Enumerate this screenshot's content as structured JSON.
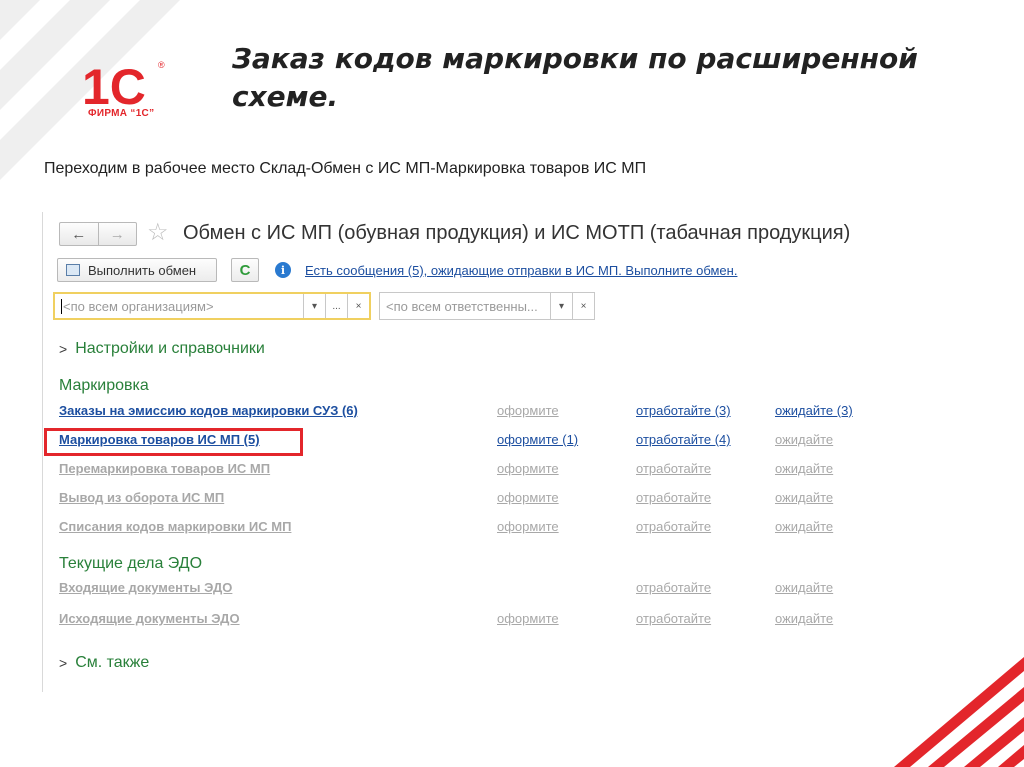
{
  "slide": {
    "title": "Заказ кодов маркировки по расширенной схеме.",
    "subtitle": "Переходим в рабочее место Склад-Обмен с ИС МП-Маркировка товаров ИС МП",
    "logo_text": "1С",
    "logo_caption": "ФИРМА “1С”"
  },
  "colors": {
    "brand_red": "#e3262b",
    "link_blue": "#1d4fa0",
    "section_green": "#29803a",
    "disabled_gray": "#a8a8a8"
  },
  "window": {
    "title": "Обмен с ИС МП (обувная продукция) и ИС МОТП (табачная продукция)",
    "nav_back": "←",
    "nav_forward": "→",
    "star_icon": "☆",
    "exec_button": "Выполнить обмен",
    "refresh_icon": "C",
    "info_icon": "i",
    "info_link": "Есть сообщения (5), ожидающие отправки в ИС МП. Выполните обмен.",
    "org_placeholder": "<по всем организациям>",
    "resp_placeholder": "<по всем ответственны...",
    "dropdown_icon": "▾",
    "more_icon": "...",
    "clear_icon": "×",
    "settings_section": "Настройки и справочники",
    "see_also_section": "См. также",
    "chevron_icon": ">",
    "marking_header": "Маркировка",
    "edo_header": "Текущие дела ЭДО"
  },
  "marking_rows": [
    {
      "name": "Заказы на эмиссию кодов маркировки СУЗ (6)",
      "c1": "оформите",
      "c2": "отработайте (3)",
      "c3": "ожидайте (3)"
    },
    {
      "name": "Маркировка товаров ИС МП (5)",
      "c1": "оформите (1)",
      "c2": "отработайте (4)",
      "c3": "ожидайте"
    },
    {
      "name": "Перемаркировка товаров ИС МП",
      "c1": "оформите",
      "c2": "отработайте",
      "c3": "ожидайте"
    },
    {
      "name": "Вывод из оборота ИС МП",
      "c1": "оформите",
      "c2": "отработайте",
      "c3": "ожидайте"
    },
    {
      "name": "Списания кодов маркировки ИС МП",
      "c1": "оформите",
      "c2": "отработайте",
      "c3": "ожидайте"
    }
  ],
  "edo_rows": [
    {
      "name": "Входящие документы ЭДО",
      "c2": "отработайте",
      "c3": "ожидайте"
    },
    {
      "name": "Исходящие документы ЭДО",
      "c1": "оформите",
      "c2": "отработайте",
      "c3": "ожидайте"
    }
  ]
}
